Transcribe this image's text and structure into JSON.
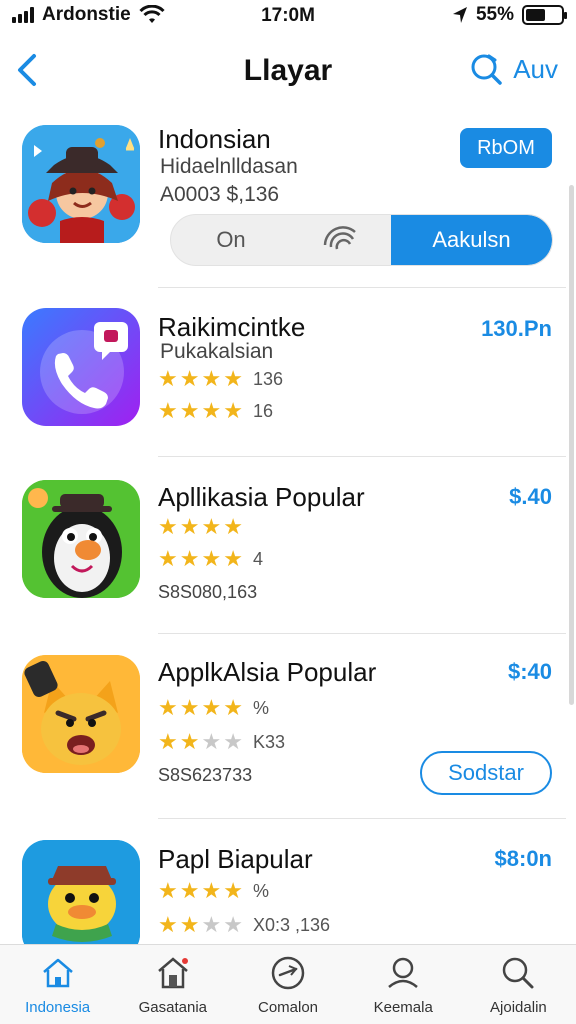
{
  "status_bar": {
    "carrier": "Ardonstie",
    "time": "17:0M",
    "battery": "55%",
    "battery_level": 0.55
  },
  "nav": {
    "back_icon": "chevron-left-icon",
    "title": "Llayar",
    "action_label": "Auv",
    "action_icon": "search-icon"
  },
  "featured": {
    "name": "Indonsian",
    "subtitle": "Hidaelnlldasan",
    "meta": "A0003 $,136",
    "button_label": "RbOM",
    "segments": [
      "On",
      "",
      "Aakulsn"
    ],
    "wifi_icon": "wifi-icon"
  },
  "apps": [
    {
      "name": "Raikimcintke",
      "subtitle": "Pukakalsian",
      "price": "130.Pn",
      "ratings": [
        {
          "stars": 4,
          "label": "136"
        },
        {
          "stars": 4,
          "label": "16"
        }
      ]
    },
    {
      "name": "Apllikasia Popular",
      "price": "$.40",
      "ratings": [
        {
          "stars": 4,
          "label": ""
        },
        {
          "stars": 4,
          "label": "4"
        }
      ],
      "meta": "S8S080,163"
    },
    {
      "name": "ApplkAlsia Popular",
      "price": "$:40",
      "ratings": [
        {
          "stars": 4,
          "label": "%"
        },
        {
          "stars": 2,
          "label": "K33"
        }
      ],
      "meta": "S8S623733",
      "button_label": "Sodstar"
    },
    {
      "name": "Papl Biapular",
      "price": "$8:0n",
      "ratings": [
        {
          "stars": 4,
          "label": "%"
        },
        {
          "stars": 2,
          "label": "X0:3 ,136"
        }
      ]
    }
  ],
  "tabs": [
    {
      "label": "Indonesia",
      "icon": "home-icon",
      "active": true
    },
    {
      "label": "Gasatania",
      "icon": "store-icon",
      "active": false
    },
    {
      "label": "Comalon",
      "icon": "compass-icon",
      "active": false
    },
    {
      "label": "Keemala",
      "icon": "profile-icon",
      "active": false
    },
    {
      "label": "Ajoidalin",
      "icon": "search-icon",
      "active": false
    }
  ],
  "colors": {
    "accent": "#1a8be3",
    "star": "#f2b51b"
  }
}
